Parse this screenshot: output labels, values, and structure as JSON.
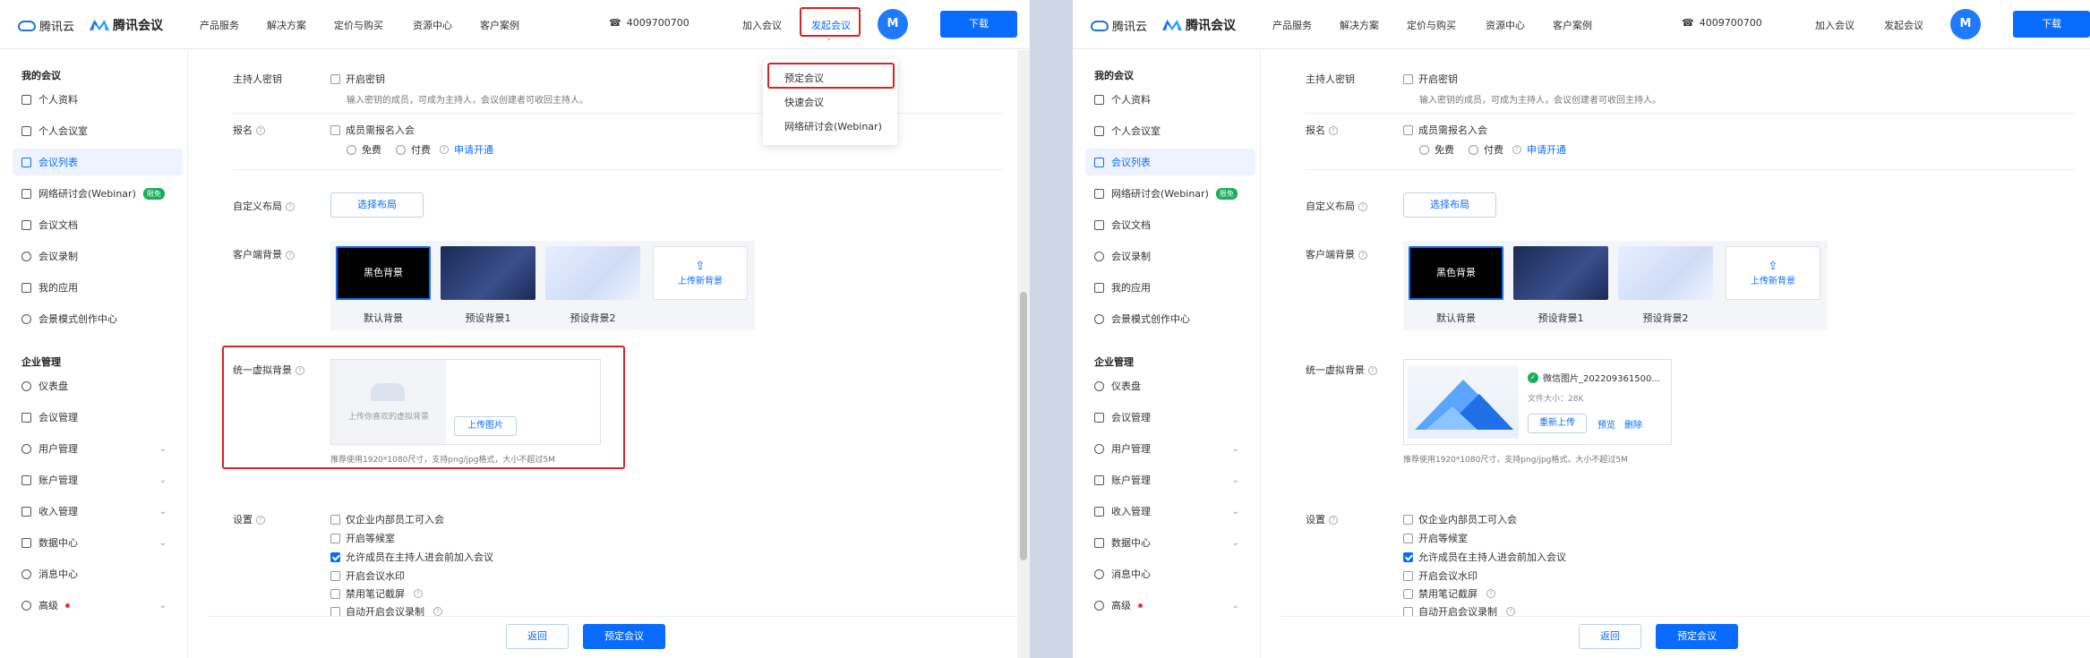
{
  "brand": {
    "cloud": "腾讯云",
    "meeting": "腾讯会议"
  },
  "nav": [
    "产品服务",
    "解决方案",
    "定价与购买",
    "资源中心",
    "客户案例"
  ],
  "phone": "4009700700",
  "actions": {
    "join": "加入会议",
    "start": "发起会议",
    "download": "下载"
  },
  "avatar_letter": "M",
  "dropdown": [
    "预定会议",
    "快速会议",
    "网络研讨会(Webinar)"
  ],
  "sidebar": {
    "my_meetings": "我的会议",
    "items": [
      "个人资料",
      "个人会议室",
      "会议列表",
      "网络研讨会(Webinar)",
      "会议文档",
      "会议录制",
      "我的应用",
      "会景模式创作中心"
    ],
    "webinar_badge": "限免",
    "enterprise": "企业管理",
    "ent_items": [
      "仪表盘",
      "会议管理",
      "用户管理",
      "账户管理",
      "收入管理",
      "数据中心",
      "消息中心",
      "高级"
    ]
  },
  "form": {
    "host_key_label": "主持人密钥",
    "host_key_cb": "开启密钥",
    "host_key_hint": "输入密钥的成员，可成为主持人，会议创建者可收回主持人。",
    "signup_label": "报名",
    "signup_cb": "成员需报名入会",
    "free": "免费",
    "paid": "付费",
    "apply": "申请开通",
    "layout_label": "自定义布局",
    "layout_btn": "选择布局",
    "client_bg_label": "客户端背景",
    "bg_black": "黑色背景",
    "bg_captions": [
      "默认背景",
      "预设背景1",
      "预设背景2"
    ],
    "upload_new_bg": "上传新背景",
    "virtual_bg_label": "统一虚拟背景",
    "virtual_placeholder": "上传你喜欢的虚拟背景",
    "upload_image": "上传图片",
    "virtual_hint": "推荐使用1920*1080尺寸，支持png/jpg格式，大小不超过5M",
    "uploaded_file": "微信图片_202209361500...",
    "file_size": "文件大小：28K",
    "reupload": "重新上传",
    "preview": "预览",
    "delete": "删除",
    "settings_label": "设置",
    "settings": [
      {
        "label": "仅企业内部员工可入会",
        "checked": false
      },
      {
        "label": "开启等候室",
        "checked": false
      },
      {
        "label": "允许成员在主持人进会前加入会议",
        "checked": true
      },
      {
        "label": "开启会议水印",
        "checked": false
      },
      {
        "label": "禁用笔记截屏",
        "checked": false
      },
      {
        "label": "自动开启会议录制",
        "checked": false
      }
    ],
    "back": "返回",
    "schedule": "预定会议"
  },
  "colors": {
    "accent": "#0a6cff",
    "highlight": "#e02020",
    "badge": "#1aad5c"
  }
}
